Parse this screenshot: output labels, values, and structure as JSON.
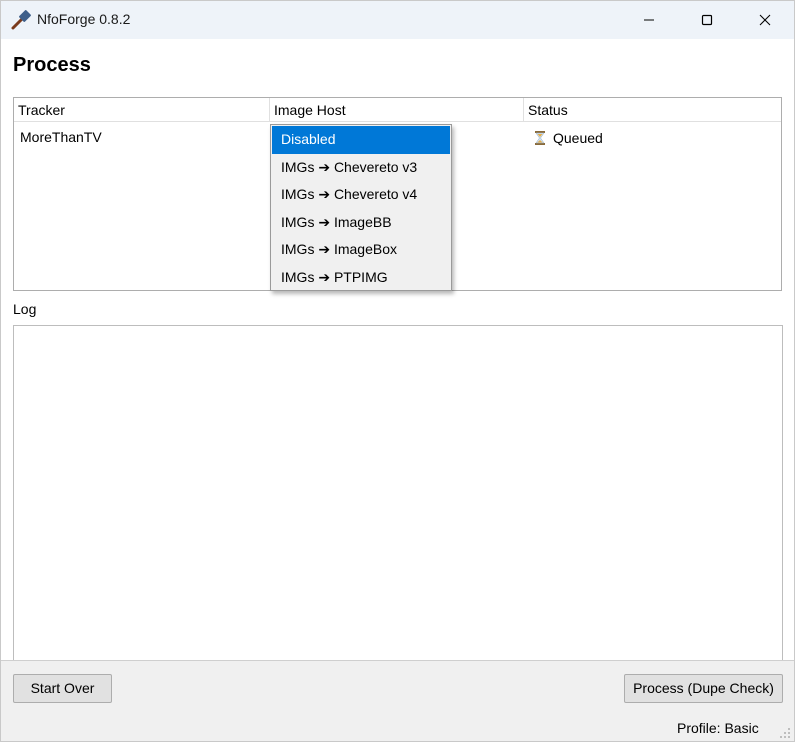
{
  "window": {
    "title": "NfoForge 0.8.2",
    "icon": "hammer-icon",
    "controls": [
      "minimize-icon",
      "maximize-icon",
      "close-icon"
    ]
  },
  "page": {
    "heading": "Process"
  },
  "table": {
    "columns": [
      "Tracker",
      "Image Host",
      "Status"
    ],
    "rows": [
      {
        "tracker": "MoreThanTV",
        "image_host": "Disabled",
        "status": "Queued",
        "status_icon": "hourglass-icon"
      }
    ]
  },
  "dropdown": {
    "selected": "Disabled",
    "options": [
      "Disabled",
      "IMGs ➔ Chevereto v3",
      "IMGs ➔ Chevereto v4",
      "IMGs ➔ ImageBB",
      "IMGs ➔ ImageBox",
      "IMGs ➔ PTPIMG"
    ]
  },
  "log": {
    "label": "Log",
    "content": ""
  },
  "footer": {
    "start_over_label": "Start Over",
    "process_label": "Process (Dupe Check)",
    "profile_text": "Profile: Basic"
  },
  "colors": {
    "accent": "#0078d7",
    "titlebar": "#eef3f9"
  }
}
